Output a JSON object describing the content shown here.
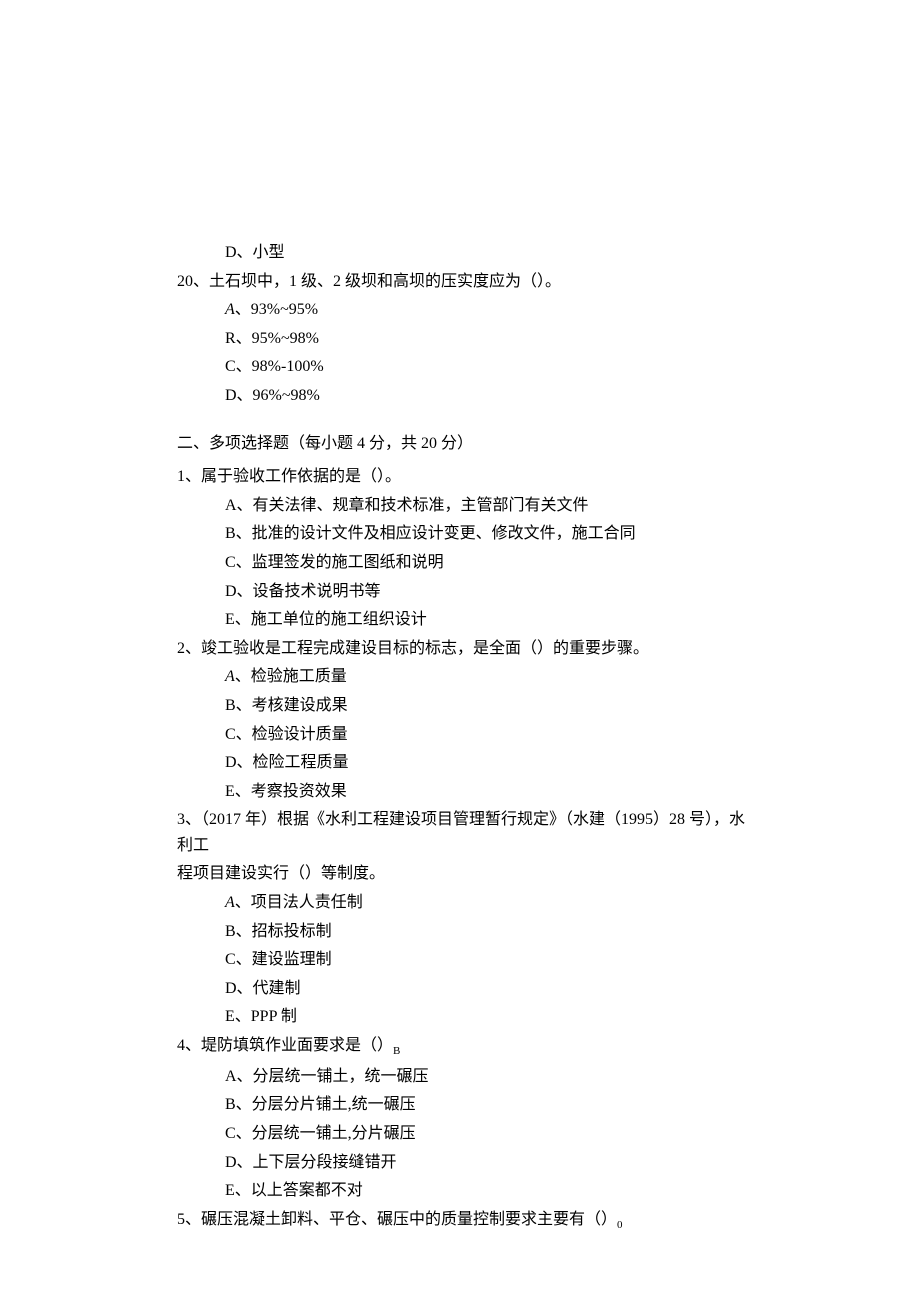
{
  "q19": {
    "options": {
      "d": "D、小型"
    }
  },
  "q20": {
    "text": "20、土石坝中，1 级、2 级坝和高坝的压实度应为（）。",
    "options": {
      "a_prefix": "A",
      "a_text": "、93%~95%",
      "b": "R、95%~98%",
      "c": "C、98%-100%",
      "d": "D、96%~98%"
    }
  },
  "section2": {
    "title": "二、多项选择题（每小题 4 分，共 20 分）"
  },
  "mq1": {
    "text": "1、属于验收工作依据的是（）。",
    "options": {
      "a": "A、有关法律、规章和技术标准，主管部门有关文件",
      "b": "B、批准的设计文件及相应设计变更、修改文件，施工合同",
      "c": "C、监理签发的施工图纸和说明",
      "d": "D、设备技术说明书等",
      "e": "E、施工单位的施工组织设计"
    }
  },
  "mq2": {
    "text": "2、竣工验收是工程完成建设目标的标志，是全面（）的重要步骤。",
    "options": {
      "a_prefix": "A",
      "a_text": "、检验施工质量",
      "b": "B、考核建设成果",
      "c": "C、检验设计质量",
      "d": "D、检险工程质量",
      "e": "E、考察投资效果"
    }
  },
  "mq3": {
    "text_line1": "3、（2017 年）根据《水利工程建设项目管理暂行规定》（水建（1995）28 号），水利工",
    "text_line2": "程项目建设实行（）等制度。",
    "options": {
      "a_prefix": "A",
      "a_text": "、项目法人责任制",
      "b": "B、招标投标制",
      "c": "C、建设监理制",
      "d": "D、代建制",
      "e": "E、PPP 制"
    }
  },
  "mq4": {
    "text": "4、堤防填筑作业面要求是（）",
    "sub_B": "B",
    "options": {
      "a": "A、分层统一铺土，统一碾压",
      "b": "B、分层分片铺土,统一碾压",
      "c": "C、分层统一铺土,分片碾压",
      "d": "D、上下层分段接缝错开",
      "e": "E、以上答案都不对"
    }
  },
  "mq5": {
    "text": "5、碾压混凝土卸料、平仓、碾压中的质量控制要求主要有（）",
    "sub_0": "0"
  }
}
